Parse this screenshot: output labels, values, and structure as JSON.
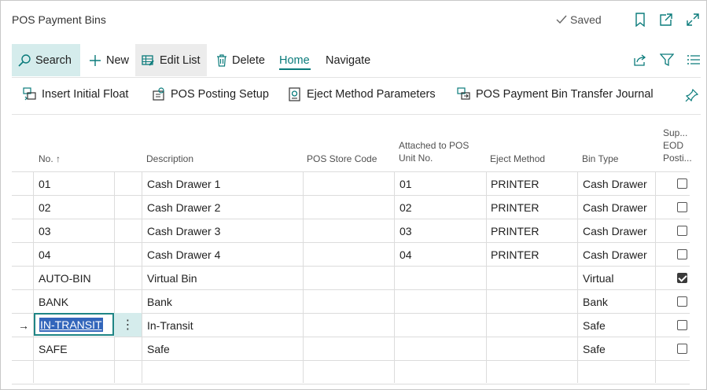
{
  "header": {
    "title": "POS Payment Bins",
    "saved_label": "Saved"
  },
  "actions": {
    "search": "Search",
    "new": "New",
    "edit_list": "Edit List",
    "delete": "Delete",
    "home": "Home",
    "navigate": "Navigate"
  },
  "promoted": {
    "insert_initial_float": "Insert Initial Float",
    "pos_posting_setup": "POS Posting Setup",
    "eject_method_parameters": "Eject Method Parameters",
    "transfer_journal": "POS Payment Bin Transfer Journal"
  },
  "columns": {
    "no": "No.",
    "sort_arrow": "↑",
    "description": "Description",
    "pos_store_code": "POS Store Code",
    "attached_line1": "Attached to POS",
    "attached_line2": "Unit No.",
    "eject_method": "Eject Method",
    "bin_type": "Bin Type",
    "eod_line1": "Sup...",
    "eod_line2": "EOD",
    "eod_line3": "Posti..."
  },
  "rows": [
    {
      "no": "01",
      "description": "Cash Drawer 1",
      "store": "",
      "unit": "01",
      "eject": "PRINTER",
      "bin_type": "Cash Drawer",
      "eod": false
    },
    {
      "no": "02",
      "description": "Cash Drawer 2",
      "store": "",
      "unit": "02",
      "eject": "PRINTER",
      "bin_type": "Cash Drawer",
      "eod": false
    },
    {
      "no": "03",
      "description": "Cash Drawer 3",
      "store": "",
      "unit": "03",
      "eject": "PRINTER",
      "bin_type": "Cash Drawer",
      "eod": false
    },
    {
      "no": "04",
      "description": "Cash Drawer 4",
      "store": "",
      "unit": "04",
      "eject": "PRINTER",
      "bin_type": "Cash Drawer",
      "eod": false
    },
    {
      "no": "AUTO-BIN",
      "description": "Virtual Bin",
      "store": "",
      "unit": "",
      "eject": "",
      "bin_type": "Virtual",
      "eod": true
    },
    {
      "no": "BANK",
      "description": "Bank",
      "store": "",
      "unit": "",
      "eject": "",
      "bin_type": "Bank",
      "eod": false
    },
    {
      "no": "IN-TRANSIT",
      "description": "In-Transit",
      "store": "",
      "unit": "",
      "eject": "",
      "bin_type": "Safe",
      "eod": false
    },
    {
      "no": "SAFE",
      "description": "Safe",
      "store": "",
      "unit": "",
      "eject": "",
      "bin_type": "Safe",
      "eod": false
    }
  ],
  "selected_row_marker": "→",
  "row_menu_glyph": "⋮",
  "colors": {
    "accent": "#0a7b7b",
    "selection_highlight": "#3366bb",
    "active_cell_bg": "#d5ecec"
  }
}
